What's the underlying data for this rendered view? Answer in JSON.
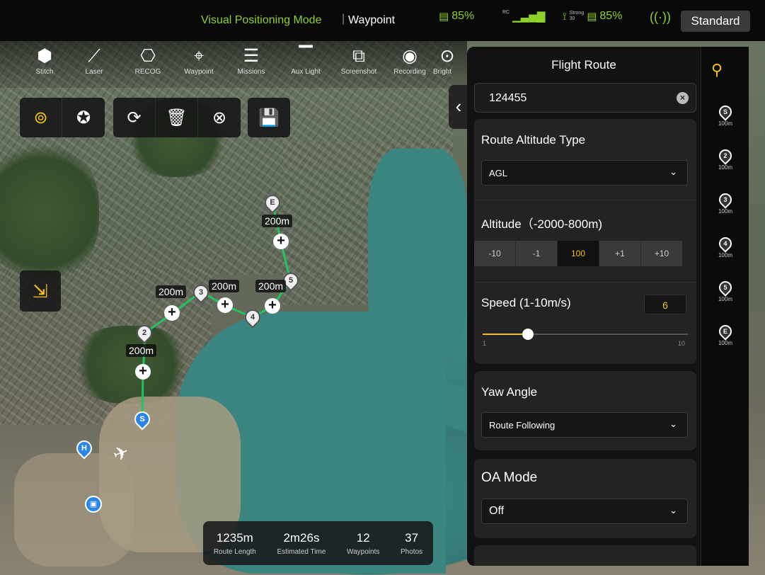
{
  "top_bar": {
    "mode": "Visual Positioning Mode",
    "separator": "|",
    "route_mode": "Waypoint",
    "aircraft_battery": "85%",
    "rc_signal_label": "RC",
    "signal_strength_label": "Strong",
    "signal_strength_value": "30",
    "rc_battery": "85%",
    "standard_button": "Standard"
  },
  "toolbar": {
    "items": [
      {
        "label": "Stitch",
        "icon": "⬢"
      },
      {
        "label": "Laser",
        "icon": "⟋"
      },
      {
        "label": "RECOG",
        "icon": "⎔"
      },
      {
        "label": "Waypoint",
        "icon": "⌖"
      },
      {
        "label": "Missions",
        "icon": "☰"
      },
      {
        "label": "Aux Light",
        "icon": "▔"
      },
      {
        "label": "Screenshot",
        "icon": "⧉"
      },
      {
        "label": "Recording",
        "icon": "◉"
      },
      {
        "label": "Bright",
        "icon": "⊙"
      }
    ]
  },
  "edit_bar": {
    "icons": [
      "⊚",
      "✪",
      "⟳",
      "🗑",
      "⊗",
      "💾"
    ]
  },
  "route": {
    "distance_labels": [
      "200m",
      "200m",
      "200m",
      "200m",
      "200m"
    ],
    "waypoints": [
      "S",
      "2",
      "3",
      "4",
      "5",
      "E"
    ],
    "home_label": "H"
  },
  "stats": {
    "route_length_value": "1235m",
    "route_length_label": "Route Length",
    "estimated_time_value": "2m26s",
    "estimated_time_label": "Estimated Time",
    "waypoints_value": "12",
    "waypoints_label": "Waypoints",
    "photos_value": "37",
    "photos_label": "Photos"
  },
  "panel": {
    "title": "Flight Route",
    "route_name": "124455",
    "altitude_type": {
      "label": "Route Altitude Type",
      "value": "AGL"
    },
    "altitude": {
      "label": "Altitude（-2000-800m)",
      "steps": [
        "-10",
        "-1",
        "100",
        "+1",
        "+10"
      ]
    },
    "speed": {
      "label": "Speed (1-10m/s)",
      "value": "6",
      "min": "1",
      "max": "10",
      "level": 6
    },
    "yaw_angle": {
      "label": "Yaw Angle",
      "value": "Route Following"
    },
    "oa_mode": {
      "label": "OA Mode",
      "value": "Off"
    }
  },
  "wp_strip": {
    "items": [
      {
        "id": "S",
        "alt": "100m"
      },
      {
        "id": "2",
        "alt": "100m"
      },
      {
        "id": "3",
        "alt": "100m"
      },
      {
        "id": "4",
        "alt": "100m"
      },
      {
        "id": "5",
        "alt": "100m"
      },
      {
        "id": "E",
        "alt": "100m"
      }
    ]
  },
  "colors": {
    "accent": "#f2c316",
    "status_green": "#8ed12a",
    "route_line": "#21c45f",
    "start_pin": "#2a86e6"
  }
}
